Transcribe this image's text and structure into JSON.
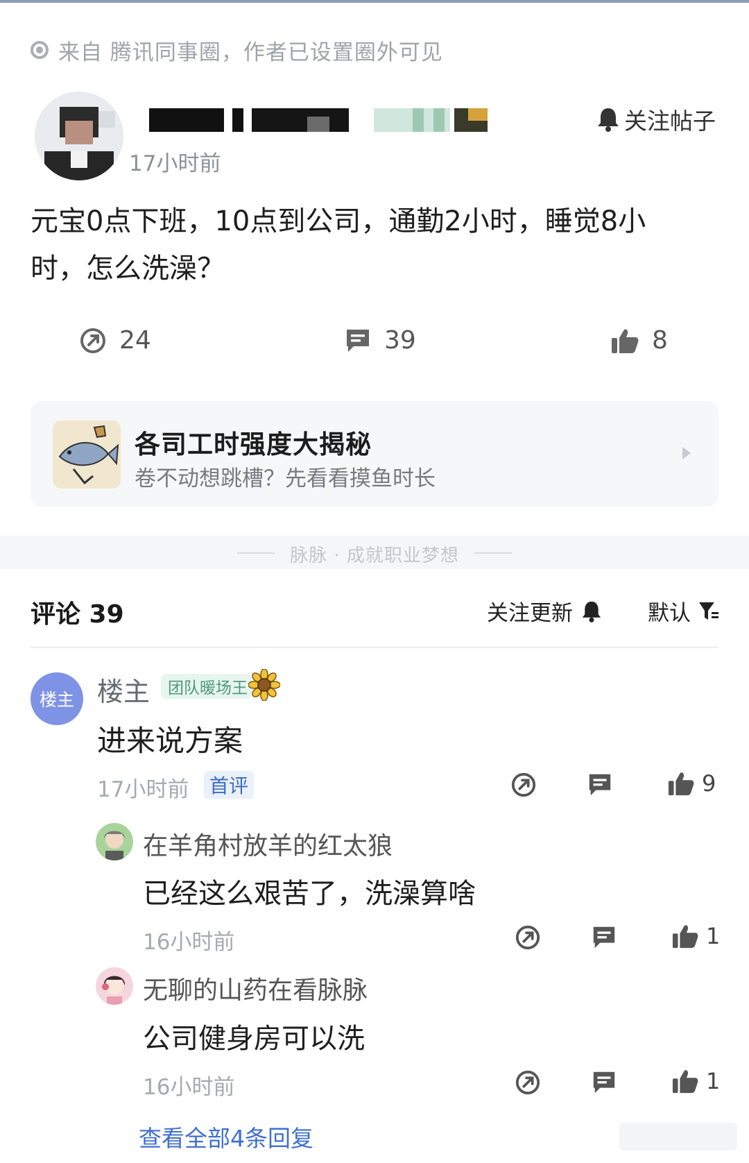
{
  "source": {
    "text": "来自 腾讯同事圈，作者已设置圈外可见",
    "icon": "circle-dot-icon"
  },
  "post": {
    "author_name": "",
    "time": "17小时前",
    "follow_label": "关注帖子",
    "text_line1": "元宝0点下班，10点到公司，通勤2小时，睡觉8小",
    "text_line2": "时，怎么洗澡？",
    "stats": {
      "shares": "24",
      "comments": "39",
      "likes": "8"
    }
  },
  "promo": {
    "title": "各司工时强度大揭秘",
    "subtitle": "卷不动想跳槽？先看看摸鱼时长"
  },
  "divider": {
    "text": "脉脉 · 成就职业梦想"
  },
  "comments_header": {
    "label": "评论 39",
    "follow_updates": "关注更新",
    "sort": "默认"
  },
  "comments": [
    {
      "avatar_text": "楼主",
      "name": "楼主",
      "badge": "团队暖场王",
      "text": "进来说方案",
      "time": "17小时前",
      "tag": "首评",
      "likes": "9"
    }
  ],
  "replies": [
    {
      "name": "在羊角村放羊的红太狼",
      "text": "已经这么艰苦了，洗澡算啥",
      "time": "16小时前",
      "likes": "1"
    },
    {
      "name": "无聊的山药在看脉脉",
      "text": "公司健身房可以洗",
      "time": "16小时前",
      "likes": "1"
    }
  ],
  "view_all": "查看全部4条回复",
  "colors": {
    "accent_blue": "#3f6fd0",
    "badge_green": "#4e9a7a",
    "op_avatar": "#7e93e6"
  }
}
